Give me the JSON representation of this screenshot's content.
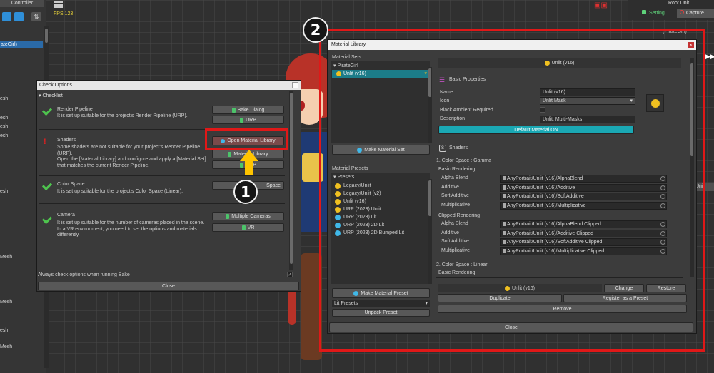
{
  "left_panel": {
    "title": "Controller",
    "selected_item": "ateGirl)",
    "mesh_items": [
      "esh",
      "esh",
      "esh",
      "esh",
      "esh",
      "Mesh",
      "Mesh",
      "esh",
      "Mesh"
    ]
  },
  "fps": "FPS 123",
  "right_top": {
    "title": "Root Unit",
    "setting": "Setting",
    "capture": "Capture",
    "pirategirl": "(PirateGirl)",
    "side_label": "Uni"
  },
  "check_options": {
    "title": "Check Options",
    "section": "Checklist",
    "items": [
      {
        "title": "Render Pipeline",
        "desc": "It is set up suitable for the project's Render Pipeline (URP).",
        "buttons": [
          "Bake Dialog",
          "URP"
        ]
      },
      {
        "title": "Shaders",
        "desc": "Some shaders are not suitable for your project's Render Pipeline (URP).\nOpen the [Material Library] and configure and apply a [Material Set] that matches the current Render Pipeline.",
        "buttons": [
          "Open Material Library",
          "Material Library",
          "URP"
        ]
      },
      {
        "title": "Color Space",
        "desc": "It is set up suitable for the project's Color Space (Linear).",
        "buttons": [
          "Space"
        ]
      },
      {
        "title": "Camera",
        "desc": "It is set up suitable for the number of cameras placed in the scene.\nIn a VR environment, you need to set the options and materials differently.",
        "buttons": [
          "Multiple Cameras",
          "VR"
        ]
      }
    ],
    "always_check": "Always check options when running Bake",
    "close": "Close"
  },
  "material_library": {
    "title": "Material Library",
    "material_sets_header": "Material Sets",
    "set_group": "PirateGirl",
    "selected_set": "Unlit (v16)",
    "make_material_set": "Make Material Set",
    "presets_header": "Material Presets",
    "presets_group": "Presets",
    "presets": [
      {
        "name": "Legacy/Unlit",
        "icon": "yellow"
      },
      {
        "name": "Legacy/Unlit (v2)",
        "icon": "yellow"
      },
      {
        "name": "Unlit (v16)",
        "icon": "yellow"
      },
      {
        "name": "URP (2023) Unlit",
        "icon": "yellow"
      },
      {
        "name": "URP (2023) Lit",
        "icon": "blue"
      },
      {
        "name": "URP (2023) 2D Lit",
        "icon": "blue"
      },
      {
        "name": "URP (2023) 2D Bumped Lit",
        "icon": "blue"
      }
    ],
    "make_material_preset": "Make Material Preset",
    "lit_presets": "Lit Presets",
    "unpack_preset": "Unpack Preset",
    "detail_title": "Unlit (v16)",
    "basic_properties": "Basic Properties",
    "props": {
      "name_label": "Name",
      "name_value": "Unlit (v16)",
      "icon_label": "Icon",
      "icon_value": "Unlit Mask",
      "black_ambient_label": "Black Ambient Required",
      "description_label": "Description",
      "description_value": "Unlit, Multi-Masks"
    },
    "default_material_btn": "Default Material ON",
    "shaders_header": "Shaders",
    "color_space_gamma": "1. Color Space : Gamma",
    "basic_rendering": "Basic Rendering",
    "clipped_rendering": "Clipped Rendering",
    "basic_rows": [
      {
        "label": "Alpha Blend",
        "value": "AnyPortrait/Unlit (v16)/AlphaBlend"
      },
      {
        "label": "Additive",
        "value": "AnyPortrait/Unlit (v16)/Additive"
      },
      {
        "label": "Soft Additive",
        "value": "AnyPortrait/Unlit (v16)/SoftAdditive"
      },
      {
        "label": "Multiplicative",
        "value": "AnyPortrait/Unlit (v16)/Multiplicative"
      }
    ],
    "clipped_rows": [
      {
        "label": "Alpha Blend",
        "value": "AnyPortrait/Unlit (v16)/AlphaBlend Clipped"
      },
      {
        "label": "Additive",
        "value": "AnyPortrait/Unlit (v16)/Additive Clipped"
      },
      {
        "label": "Soft Additive",
        "value": "AnyPortrait/Unlit (v16)/SoftAdditive Clipped"
      },
      {
        "label": "Multiplicative",
        "value": "AnyPortrait/Unlit (v16)/Multiplicative Clipped"
      }
    ],
    "color_space_linear": "2. Color Space : Linear",
    "basic_rendering_2": "Basic Rendering",
    "bottom_selected": "Unlit (v16)",
    "change": "Change",
    "restore": "Restore",
    "duplicate": "Duplicate",
    "register": "Register as a Preset",
    "remove": "Remove",
    "close": "Close"
  },
  "annotations": {
    "badge1": "1",
    "badge2": "2"
  },
  "colors": {
    "highlight": "#e01818",
    "accent_teal": "#1aa8b4",
    "arrow": "#ffc400"
  }
}
